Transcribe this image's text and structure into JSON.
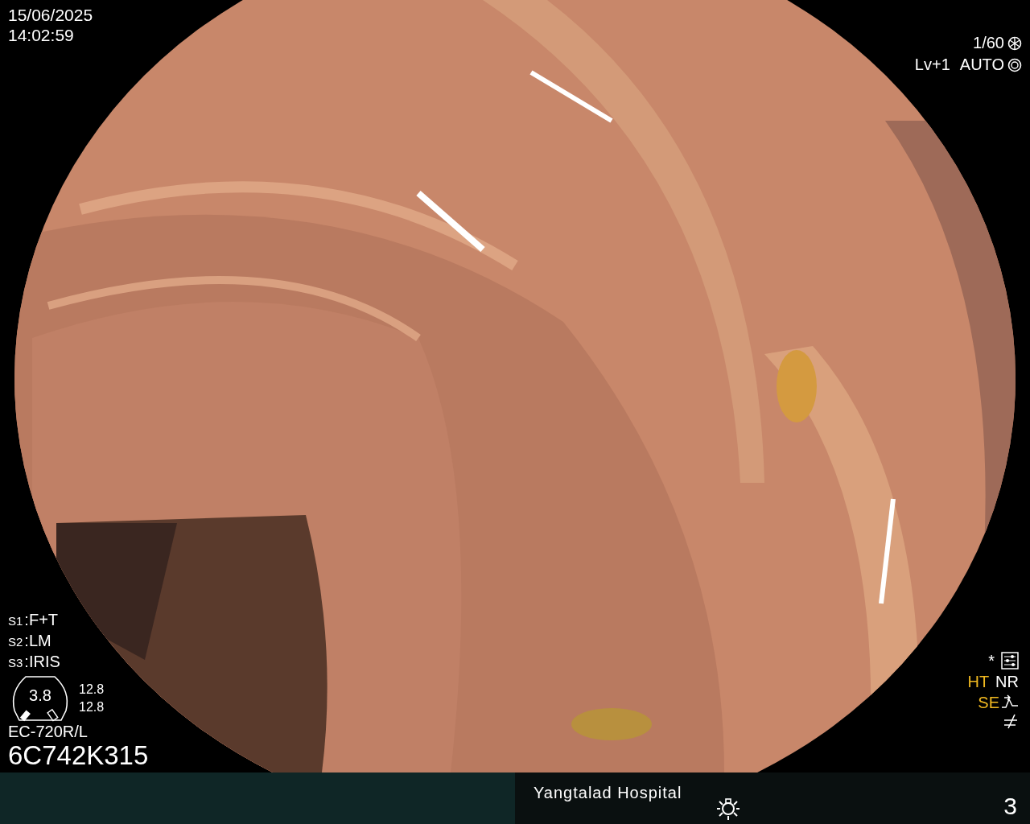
{
  "datetime": {
    "date": "15/06/2025",
    "time": "14:02:59"
  },
  "exposure": {
    "shutter": "1/60",
    "level": "Lv+1",
    "mode": "AUTO"
  },
  "scope_switches": [
    {
      "label": "S1",
      "value": ":F+T"
    },
    {
      "label": "S2",
      "value": ":LM"
    },
    {
      "label": "S3",
      "value": ":IRIS"
    }
  ],
  "gauge": {
    "value": "3.8",
    "readings": [
      "12.8",
      "12.8"
    ]
  },
  "scope": {
    "model": "EC-720R/L",
    "serial": "6C742K315"
  },
  "enhancement": {
    "marker": "*",
    "modes": [
      {
        "label": "HT",
        "active": true
      },
      {
        "label": "NR",
        "active": false
      },
      {
        "label": "SE",
        "active": true
      }
    ]
  },
  "footer": {
    "hospital": "Yangtalad Hospital",
    "number": "3"
  }
}
